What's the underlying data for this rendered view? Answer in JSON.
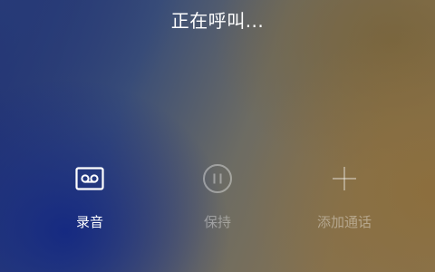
{
  "status": {
    "title": "正在呼叫..."
  },
  "actions": [
    {
      "label": "录音",
      "icon": "voicemail-icon",
      "enabled": true
    },
    {
      "label": "保持",
      "icon": "pause-circle-icon",
      "enabled": false
    },
    {
      "label": "添加通话",
      "icon": "plus-icon",
      "enabled": false
    }
  ],
  "colors": {
    "text": "#ffffff",
    "disabled_text": "rgba(255,255,255,0.38)",
    "bg_left": "#1f2f73",
    "bg_right": "#8a7450"
  }
}
